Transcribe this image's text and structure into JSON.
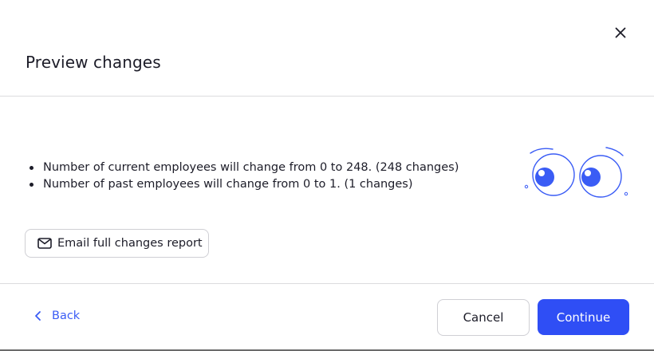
{
  "dialog": {
    "title": "Preview changes",
    "close_icon": "close-icon"
  },
  "changes": [
    "Number of current employees will change from 0 to 248. (248 changes)",
    "Number of past employees will change from 0 to 1. (1 changes)"
  ],
  "illustration": {
    "icon": "peeking-eyes-icon",
    "color": "#3a5cf5"
  },
  "email_button": {
    "icon": "mail-icon",
    "label": "Email full changes report"
  },
  "footer": {
    "back_icon": "chevron-left-icon",
    "back_label": "Back",
    "cancel_label": "Cancel",
    "continue_label": "Continue"
  },
  "colors": {
    "accent": "#2f4ef5",
    "link": "#3a5cf5",
    "text": "#1c1c28",
    "divider": "#dcdcde"
  }
}
